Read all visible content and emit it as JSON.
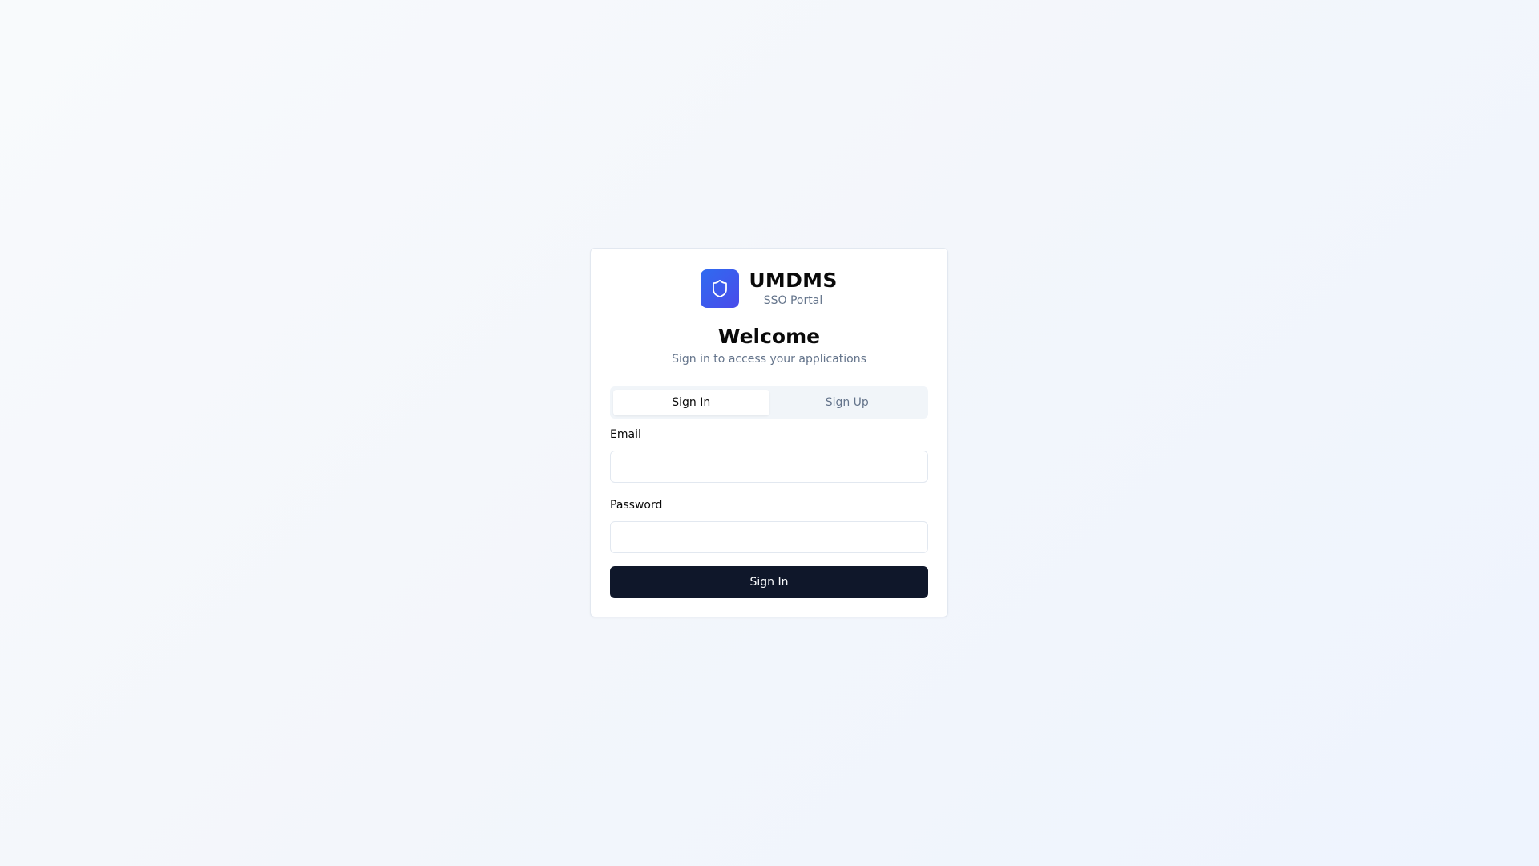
{
  "brand": {
    "name": "UMDMS",
    "subtitle": "SSO Portal",
    "icon": "shield-icon",
    "logo_color": "#3b5bf0"
  },
  "heading": {
    "title": "Welcome",
    "subtitle": "Sign in to access your applications"
  },
  "tabs": [
    {
      "label": "Sign In",
      "active": true
    },
    {
      "label": "Sign Up",
      "active": false
    }
  ],
  "form": {
    "email": {
      "label": "Email",
      "value": ""
    },
    "password": {
      "label": "Password",
      "value": ""
    },
    "submit_label": "Sign In"
  },
  "colors": {
    "primary_button": "#0f172a",
    "muted_text": "#64748b",
    "border": "#e2e8f0"
  }
}
